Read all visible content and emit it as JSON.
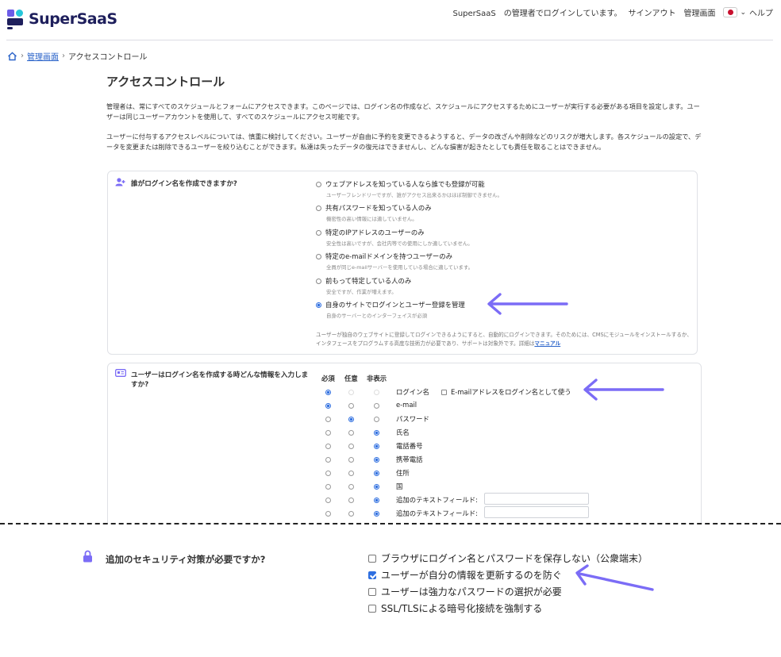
{
  "header": {
    "logo_text": "SuperSaaS",
    "logged_in_text": "SuperSaaS　の管理者でログインしています。",
    "sign_out": "サインアウト",
    "admin": "管理画面",
    "help": "ヘルプ"
  },
  "breadcrumb": {
    "home_icon": "home-icon",
    "admin_link": "管理画面",
    "current": "アクセスコントロール"
  },
  "page": {
    "title": "アクセスコントロール",
    "intro1": "管理者は、常にすべてのスケジュールとフォームにアクセスできます。このページでは、ログイン名の作成など、スケジュールにアクセスするためにユーザーが実行する必要がある項目を設定します。ユーザーは同じユーザーアカウントを使用して、すべてのスケジュールにアクセス可能です。",
    "intro2": "ユーザーに付与するアクセスレベルについては、慎重に検討してください。ユーザーが自由に予約を変更できるようすると、データの改ざんや削除などのリスクが増大します。各スケジュールの設定で、データを変更または削除できるユーザーを絞り込むことができます。私達は失ったデータの復元はできませんし、どんな損害が起きたとしても責任を取ることはできません。"
  },
  "who_can_create": {
    "title": "誰がログイン名を作成できますか?",
    "options": [
      {
        "label": "ウェブアドレスを知っている人なら誰でも登録が可能",
        "sub": "ユーザーフレンドリーですが、誰がアクセス出来るかはほぼ制御できません。",
        "selected": false
      },
      {
        "label": "共有パスワードを知っている人のみ",
        "sub": "機密性の高い情報には適していません。",
        "selected": false
      },
      {
        "label": "特定のIPアドレスのユーザーのみ",
        "sub": "安全性は高いですが、会社内等での使用にしか適していません。",
        "selected": false
      },
      {
        "label": "特定のe-mailドメインを持つユーザーのみ",
        "sub": "全員が同じe-mailサーバーを使用している場合に適しています。",
        "selected": false
      },
      {
        "label": "前もって特定している人のみ",
        "sub": "安全ですが、作業が増えます。",
        "selected": false
      },
      {
        "label": "自身のサイトでログインとユーザー登録を管理",
        "sub": "自身のサーバーとのインターフェイスが必須",
        "selected": true
      }
    ],
    "note": "ユーザーが独自のウェブサイトに登録してログインできるようにすると、自動的にログインできます。そのためには、CMSにモジュールをインストールするか、インタフェースをプログラムする高度な技術力が必要であり、サポートは対象外です。詳細は",
    "note_link": "マニュアル"
  },
  "user_info": {
    "title": "ユーザーはログイン名を作成する時どんな情報を入力しますか?",
    "col_required": "必須",
    "col_optional": "任意",
    "col_hidden": "非表示",
    "email_as_login": "E-mailアドレスをログイン名として使う",
    "rows": [
      {
        "label": "ログイン名",
        "state": 0,
        "disabled_other": true,
        "input": false
      },
      {
        "label": "e-mail",
        "state": 0,
        "input": false
      },
      {
        "label": "パスワード",
        "state": 1,
        "input": false
      },
      {
        "label": "氏名",
        "state": 2,
        "input": false
      },
      {
        "label": "電話番号",
        "state": 2,
        "input": false
      },
      {
        "label": "携帯電話",
        "state": 2,
        "input": false
      },
      {
        "label": "住所",
        "state": 2,
        "input": false
      },
      {
        "label": "国",
        "state": 2,
        "input": false
      },
      {
        "label": "追加のテキストフィールド:",
        "state": 2,
        "input": true
      },
      {
        "label": "追加のテキストフィールド:",
        "state": 2,
        "input": true
      }
    ]
  },
  "security": {
    "title": "追加のセキュリティ対策が必要ですか?",
    "options": [
      {
        "label": "ブラウザにログイン名とパスワードを保存しない（公衆端末）",
        "checked": false
      },
      {
        "label": "ユーザーが自分の情報を更新するのを防ぐ",
        "checked": true
      },
      {
        "label": "ユーザーは強力なパスワードの選択が必要",
        "checked": false
      },
      {
        "label": "SSL/TLSによる暗号化接続を強制する",
        "checked": false
      }
    ]
  },
  "colors": {
    "accent": "#2f6fe0",
    "arrow": "#7b6cf6",
    "logo": "#1e1f5c"
  }
}
